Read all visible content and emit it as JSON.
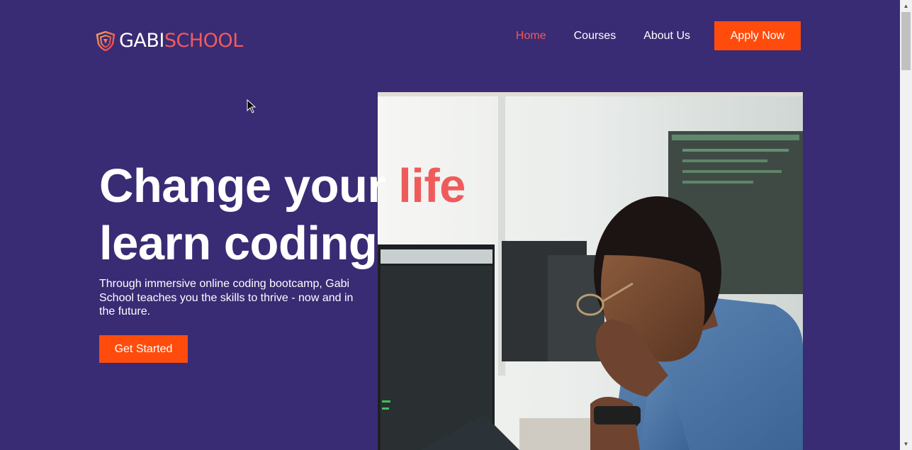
{
  "header": {
    "logo_text_primary": "GABI",
    "logo_text_secondary": "SCHOOL",
    "nav": [
      {
        "label": "Home",
        "active": true
      },
      {
        "label": "Courses",
        "active": false
      },
      {
        "label": "About Us",
        "active": false
      }
    ],
    "apply_label": "Apply Now"
  },
  "hero": {
    "headline_line1": "Change your ",
    "headline_accent": "life",
    "headline_line2": "learn coding",
    "subtext": "Through immersive online coding bootcamp, Gabi School teaches you the skills to thrive - now and in the future.",
    "cta_label": "Get Started",
    "image_icon": "man-at-computer-photo"
  },
  "colors": {
    "background": "#392b74",
    "accent": "#ef5b5b",
    "button": "#ff4c0d",
    "text": "#ffffff"
  }
}
